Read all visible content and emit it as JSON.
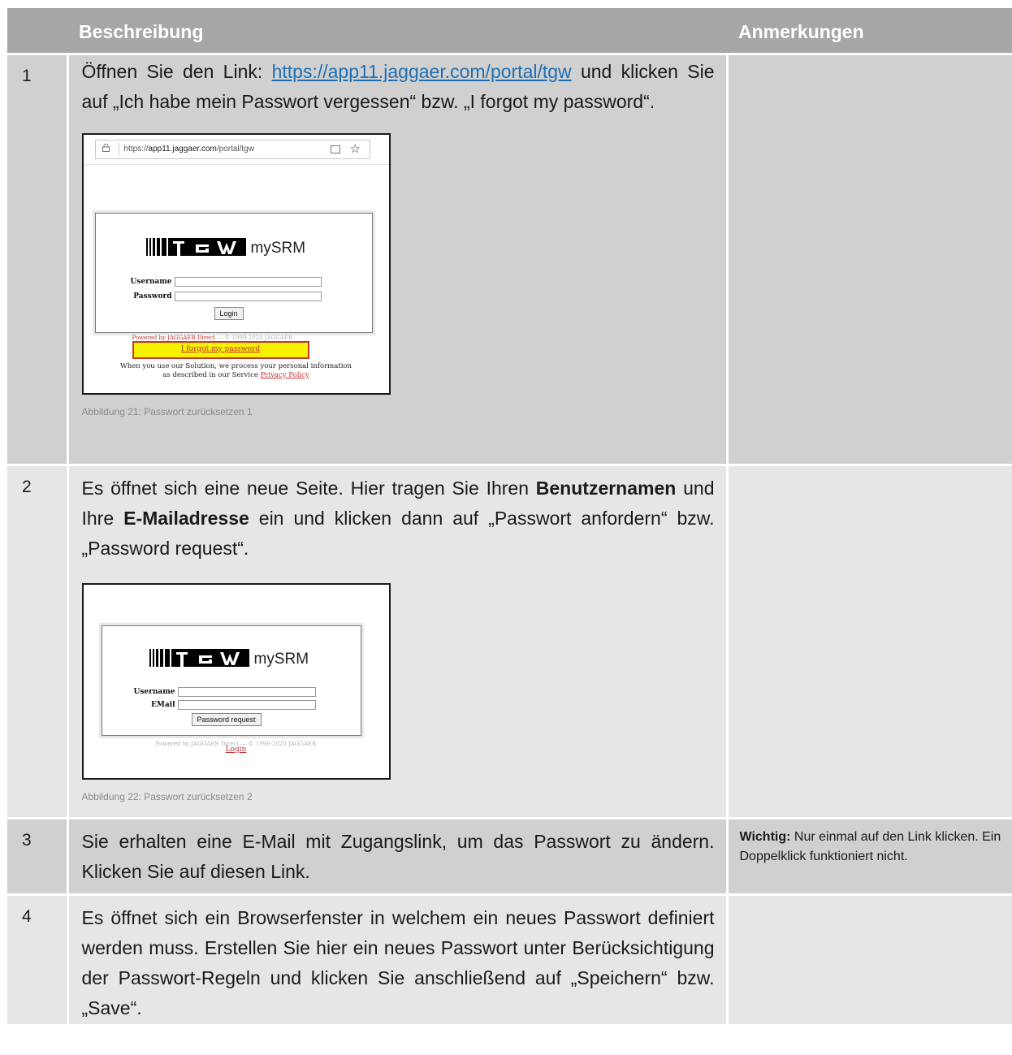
{
  "header": {
    "number": "",
    "description": "Beschreibung",
    "notes": "Anmerkungen"
  },
  "rows": [
    {
      "number": "1",
      "text_before": "Öffnen Sie den Link: ",
      "link": "https://app11.jaggaer.com/portal/tgw",
      "text_after": " und klicken Sie auf „Ich habe mein Passwort vergessen“ bzw. „I forgot my password“.",
      "caption": "Abbildung 21: Passwort zurücksetzen 1",
      "note_bold": "",
      "note": ""
    },
    {
      "number": "2",
      "text_1": "Es öffnet sich eine neue Seite. Hier tragen Sie Ihren ",
      "bold_1": "Benutzernamen",
      "text_2": " und Ihre ",
      "bold_2": "E-Mailadresse",
      "text_3": " ein und klicken dann auf „Passwort anfordern“ bzw. „Password request“.",
      "caption": "Abbildung 22: Passwort zurücksetzen 2",
      "note": ""
    },
    {
      "number": "3",
      "text": "Sie erhalten eine E-Mail mit Zugangslink, um das Passwort zu ändern. Klicken Sie auf diesen Link.",
      "note_bold": "Wichtig:",
      "note": " Nur einmal auf den Link klicken. Ein Doppelklick funktioniert nicht."
    },
    {
      "number": "4",
      "text": "Es öffnet sich ein Browserfenster in welchem ein neues Passwort definiert werden muss. Erstellen Sie hier ein neues Passwort unter Berücksichtigung der Passwort-Regeln und klicken Sie anschließend auf „Speichern“ bzw. „Save“.",
      "note": ""
    }
  ],
  "screenshot1": {
    "url_prefix": "https://",
    "url_host": "app11.jaggaer.com",
    "url_path": "/portal/tgw",
    "logo_text": "mySRM",
    "username_label": "Username",
    "password_label": "Password",
    "login_button": "Login",
    "powered_red": "Powered by JAGGAER Direct",
    "powered_rest": " — © 1999-2020 JAGGAER",
    "forgot_link": "I forgot my password",
    "privacy_line1": "When you use our Solution, we process your personal information",
    "privacy_line2": "as described in our Service ",
    "privacy_link": "Privacy Policy",
    "icons": [
      "lock-icon",
      "reader-view-icon",
      "star-icon"
    ]
  },
  "screenshot2": {
    "logo_text": "mySRM",
    "username_label": "Username",
    "email_label": "EMail",
    "request_button": "Password request",
    "powered": "Powered by JAGGAER Direct — © 1999-2020 JAGGAER",
    "login_link": "Login"
  },
  "colors": {
    "header_bg": "#a6a6a6",
    "row_dark": "#d0d0d0",
    "row_light": "#e6e6e6",
    "link": "#1f6fb2",
    "highlight": "#f7f200"
  }
}
